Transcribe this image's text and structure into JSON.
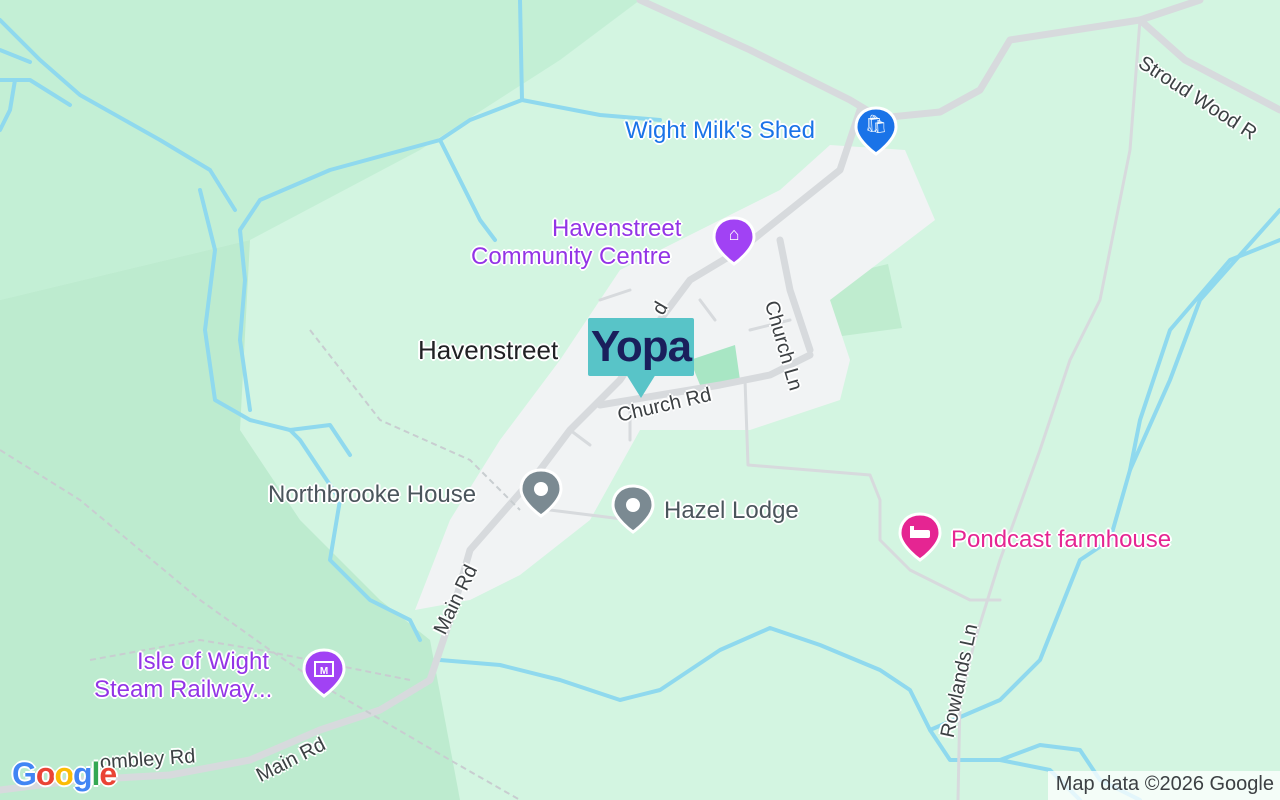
{
  "colors": {
    "land": "#d3f5e1",
    "forest": "#bff0d3",
    "park": "#c1efd2",
    "urban": "#f1f3f4",
    "water": "#8fd9ee",
    "road": "#d7dadd",
    "shop_pin": "#1a73e8",
    "community_pin": "#a142f4",
    "generic_pin": "#7b8a92",
    "lodging_pin": "#e52592",
    "shop_text": "#1a73e8",
    "community_text": "#9334e6",
    "generic_text": "#4b555c",
    "lodging_text": "#e52592",
    "marker_bg": "#58c4c8",
    "marker_text": "#1a1f5c"
  },
  "place": {
    "name": "Havenstreet"
  },
  "marker": {
    "label": "Yopa"
  },
  "pois": {
    "shop": {
      "name": "Wight Milk's Shed",
      "icon": "shopping-bag-icon"
    },
    "community": {
      "line1": "Havenstreet",
      "line2": "Community Centre",
      "icon": "community-building-icon"
    },
    "northbrooke": {
      "name": "Northbrooke House",
      "icon": "generic-dot-icon"
    },
    "hazel": {
      "name": "Hazel Lodge",
      "icon": "generic-dot-icon"
    },
    "pondcast": {
      "name": "Pondcast farmhouse",
      "icon": "bed-icon"
    },
    "railway": {
      "line1": "Isle of Wight",
      "line2": "Steam Railway...",
      "icon": "museum-icon"
    }
  },
  "roads": {
    "stroud_wood": "Stroud Wood R",
    "church_ln": "Church Ln",
    "church_rd": "Church Rd",
    "main_rd_upper": "Main Rd",
    "main_rd_lower": "Main Rd",
    "combley_rd": "ombley Rd",
    "rowlands_ln": "Rowlands Ln",
    "road_fragment": "d"
  },
  "branding": {
    "logo": "Google",
    "attribution": "Map data ©2026 Google"
  }
}
